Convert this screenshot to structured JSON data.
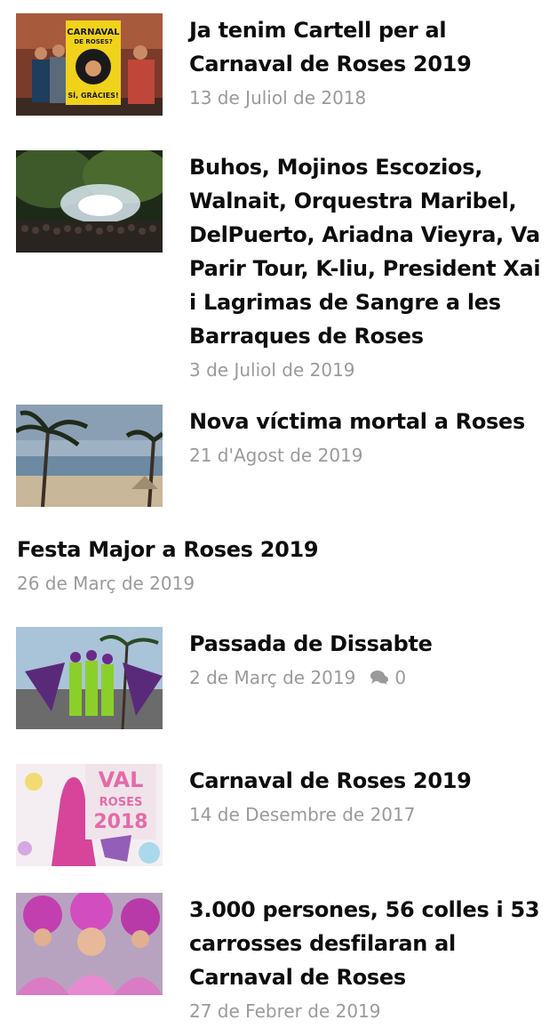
{
  "posts": [
    {
      "title": "Ja tenim Cartell per al Carnaval de Roses 2019",
      "date": "13 de Juliol de 2018",
      "poster_text": [
        "CARNAVAL",
        "DE ROSES?",
        "SÍ, GRÀCIES!"
      ]
    },
    {
      "title": "Buhos, Mojinos Escozios, Walnait, Orquestra Maribel, DelPuerto, Ariadna Vieyra, Va Parir Tour, K-liu, President Xai i Lagrimas de Sangre a les Barraques de Roses",
      "date": "3 de Juliol de 2019"
    },
    {
      "title": "Nova víctima mortal a Roses",
      "date": "21 d'Agost de 2019"
    },
    {
      "title": "Festa Major a Roses 2019",
      "date": "26 de Març de 2019"
    },
    {
      "title": "Passada de Dissabte",
      "date": "2 de Març de 2019",
      "comments": "0"
    },
    {
      "title": "Carnaval de Roses 2019",
      "date": "14 de Desembre de 2017",
      "poster_text": [
        "VAL",
        "ROSES",
        "2018"
      ]
    },
    {
      "title": "3.000 persones, 56 colles i 53 carrosses desfilaran al Carnaval de Roses",
      "date": "27 de Febrer de 2019"
    }
  ],
  "colors": {
    "title": "#0d0d0d",
    "meta": "#9a9a9a"
  }
}
